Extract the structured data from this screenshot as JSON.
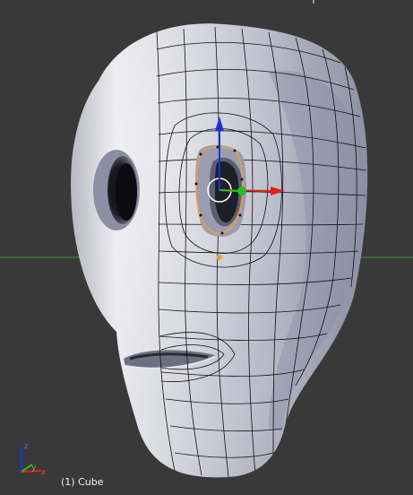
{
  "viewport": {
    "object_label": "(1) Cube",
    "colors": {
      "background": "#393939",
      "grid_line": "#3f8f3f",
      "mesh_surface": "#c8c9d2",
      "wire": "#111111",
      "selection": "#f0a030",
      "x_axis": "#e02020",
      "y_axis": "#20c020",
      "z_axis": "#2030d0"
    },
    "axis_widget": {
      "labels": {
        "x": "x",
        "y": "y",
        "z": "z"
      }
    },
    "transform_gizmo": {
      "axes": [
        "x",
        "y",
        "z"
      ]
    }
  }
}
